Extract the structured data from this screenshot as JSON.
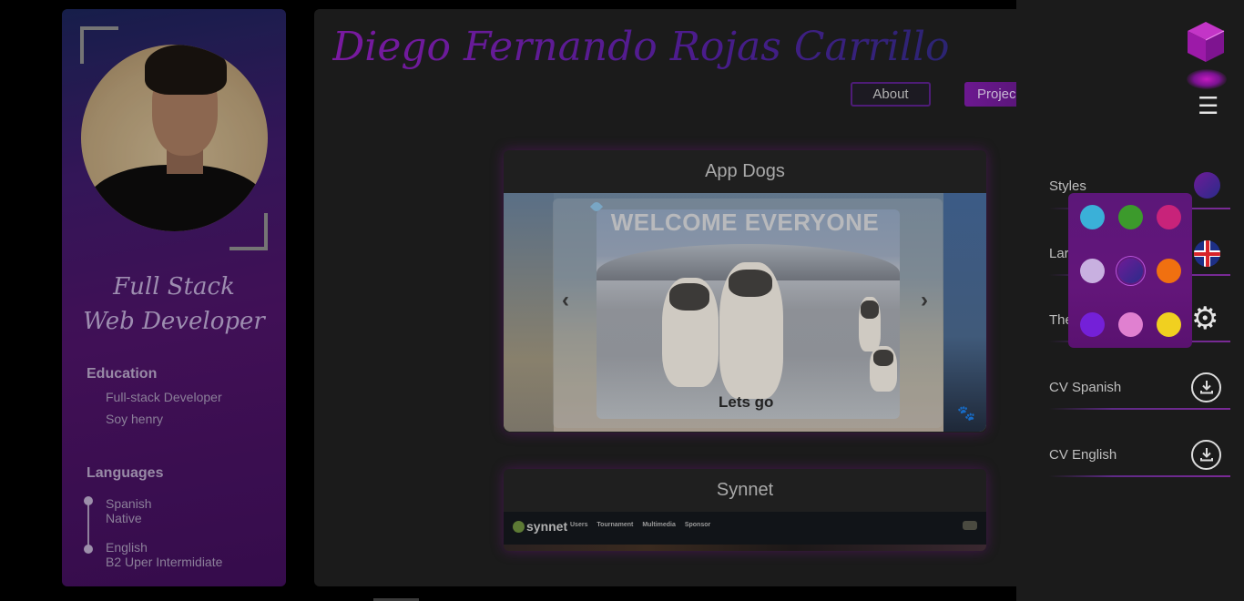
{
  "profile": {
    "role_line1": "Full Stack",
    "role_line2": "Web Developer",
    "education_title": "Education",
    "education_items": [
      "Full-stack Developer",
      "Soy henry"
    ],
    "languages_title": "Languages",
    "languages": [
      {
        "name": "Spanish",
        "level": "Native"
      },
      {
        "name": "English",
        "level": "B2 Uper Intermidiate"
      }
    ]
  },
  "header": {
    "name": "Diego Fernando Rojas Carrillo",
    "nav": {
      "about": "About",
      "projects": "Projec"
    }
  },
  "projects": [
    {
      "title": "App Dogs",
      "slide_heading": "WELCOME EVERYONE",
      "slide_button": "Lets go",
      "prev": "‹",
      "next": "›",
      "paw_icon": "🐾"
    },
    {
      "title": "Synnet",
      "logo": "synnet",
      "menu": [
        "Users",
        "Tournament",
        "Multimedia",
        "Sponsor"
      ]
    }
  ],
  "sidebar": {
    "menu_icon": "☰",
    "options": {
      "styles": "Styles",
      "language": "Lar",
      "theme": "The",
      "cv_spanish": "CV Spanish",
      "cv_english": "CV English"
    },
    "gear_icon": "⚙",
    "palette": [
      "#3ab0d8",
      "#3c9a2c",
      "#c8237a",
      "#c8b0e0",
      "#4b1a86",
      "#f07010",
      "#7420d8",
      "#e080d0",
      "#f0d020"
    ],
    "selected_style": "#4b1a86"
  }
}
